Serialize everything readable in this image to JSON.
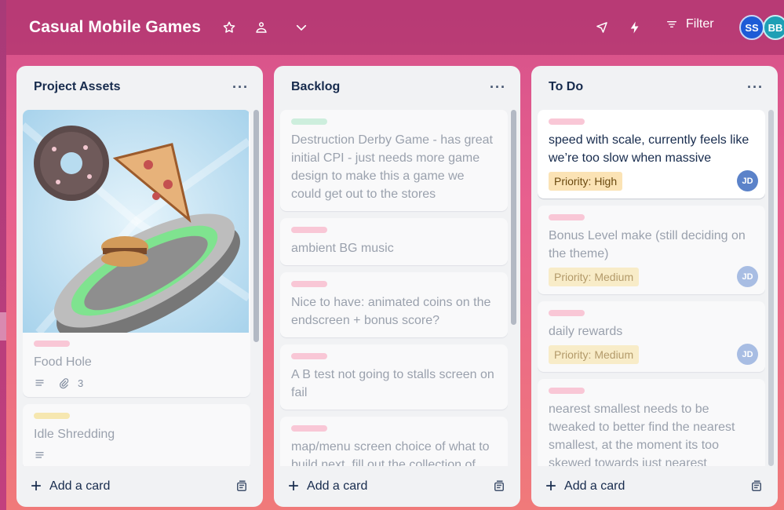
{
  "board": {
    "title": "Casual Mobile Games",
    "filter_label": "Filter",
    "members": [
      {
        "initials": "SS",
        "color": "#1d5bd6"
      },
      {
        "initials": "BB",
        "color": "#1e9fb5"
      }
    ]
  },
  "lists": [
    {
      "title": "Project Assets",
      "add_label": "Add a card",
      "cards": [
        {
          "title": "Food Hole",
          "label_color": "#f9c7d6",
          "description_icon": "description-icon",
          "attachments": "3",
          "has_image": true
        },
        {
          "title": "Idle Shredding",
          "label_color": "#f6e7b0",
          "description_icon": "description-icon"
        }
      ]
    },
    {
      "title": "Backlog",
      "add_label": "Add a card",
      "cards": [
        {
          "title": "Destruction Derby Game - has great initial CPI - just needs more game design to make this a game we could get out to the stores",
          "label_color": "#cdeedd"
        },
        {
          "title": "ambient BG music",
          "label_color": "#f9c7d6"
        },
        {
          "title": "Nice to have: animated coins on the endscreen + bonus score?",
          "label_color": "#f9c7d6"
        },
        {
          "title": "A B test not going to stalls screen on fail",
          "label_color": "#f9c7d6"
        },
        {
          "title": "map/menu screen choice of what to build next, fill out the collection of dishes",
          "label_color": "#f9c7d6"
        }
      ]
    },
    {
      "title": "To Do",
      "add_label": "Add a card",
      "cards": [
        {
          "title": "speed with scale, currently feels like we’re too slow when massive",
          "label_color": "#f9c7d6",
          "priority": "Priority: High",
          "priority_color": "#fbe3b5",
          "member": "JD"
        },
        {
          "title": "Bonus Level make (still deciding on the theme)",
          "label_color": "#f9c7d6",
          "priority": "Priority: Medium",
          "priority_color": "#f8ecc8",
          "member": "JD"
        },
        {
          "title": "daily rewards",
          "label_color": "#f9c7d6",
          "priority": "Priority: Medium",
          "priority_color": "#f8ecc8",
          "member": "JD"
        },
        {
          "title": "nearest smallest needs to be tweaked to better find the nearest smallest, at the moment its too skewed towards just nearest",
          "label_color": "#f9c7d6"
        }
      ]
    }
  ]
}
